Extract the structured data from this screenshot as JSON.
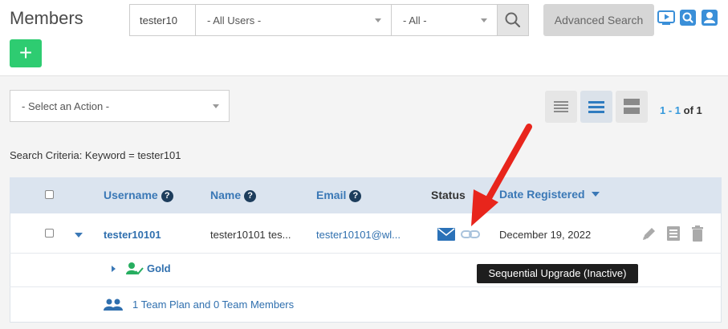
{
  "header": {
    "title": "Members",
    "add_label": "+",
    "keyword_value": "tester10",
    "user_filter": "- All Users -",
    "status_filter": "- All -",
    "advanced_search_label": "Advanced Search"
  },
  "toolbar": {
    "action_placeholder": "- Select an Action -",
    "pagination": {
      "start": "1",
      "sep": " - ",
      "end": "1",
      "of_label": " of ",
      "total": "1"
    }
  },
  "criteria": "Search Criteria: Keyword = tester101",
  "table": {
    "headers": {
      "username": "Username",
      "name": "Name",
      "email": "Email",
      "status": "Status",
      "date": "Date Registered"
    },
    "row": {
      "username": "tester10101",
      "name": "tester10101 tes...",
      "email": "tester10101@wl...",
      "date": "December 19, 2022",
      "level": "Gold",
      "team_info": "1 Team Plan and 0 Team Members"
    }
  },
  "tooltip": "Sequential Upgrade (Inactive)",
  "colors": {
    "accent": "#3a78b6",
    "add": "#2ecc71",
    "annotation": "#e8251c"
  }
}
